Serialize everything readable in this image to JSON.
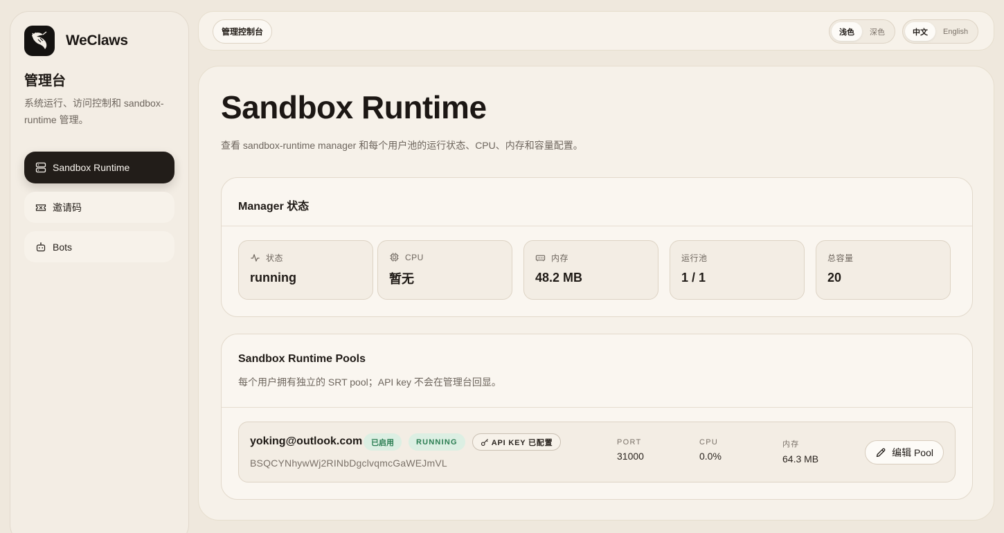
{
  "brand": {
    "name": "WeClaws",
    "logo_icon": "lobster-logo"
  },
  "sidebar": {
    "title": "管理台",
    "description": "系统运行、访问控制和 sandbox-runtime 管理。",
    "items": [
      {
        "label": "Sandbox Runtime",
        "icon": "server-icon",
        "active": true
      },
      {
        "label": "邀请码",
        "icon": "ticket-icon",
        "active": false
      },
      {
        "label": "Bots",
        "icon": "bot-icon",
        "active": false
      }
    ]
  },
  "topbar": {
    "breadcrumb": "管理控制台",
    "theme": {
      "light": "浅色",
      "dark": "深色",
      "selected": "浅色"
    },
    "language": {
      "zh": "中文",
      "en": "English",
      "selected": "中文"
    }
  },
  "main": {
    "title": "Sandbox Runtime",
    "description": "查看 sandbox-runtime manager 和每个用户池的运行状态、CPU、内存和容量配置。",
    "manager": {
      "title": "Manager 状态",
      "stats": [
        {
          "label": "状态",
          "value": "running",
          "icon": "activity-icon"
        },
        {
          "label": "CPU",
          "value": "暂无",
          "icon": "cpu-icon"
        },
        {
          "label": "内存",
          "value": "48.2 MB",
          "icon": "memory-icon"
        },
        {
          "label": "运行池",
          "value": "1 / 1",
          "icon": ""
        },
        {
          "label": "总容量",
          "value": "20",
          "icon": ""
        }
      ]
    },
    "pools": {
      "title": "Sandbox Runtime Pools",
      "subtitle": "每个用户拥有独立的 SRT pool；API key 不会在管理台回显。",
      "rows": [
        {
          "email": "yoking@outlook.com",
          "badge_enabled": "已启用",
          "badge_status": "RUNNING",
          "badge_apikey": "API KEY 已配置",
          "id": "BSQCYNhywWj2RINbDgclvqmcGaWEJmVL",
          "port_label": "PORT",
          "port": "31000",
          "cpu_label": "CPU",
          "cpu": "0.0%",
          "mem_label": "内存",
          "mem": "64.3 MB",
          "edit_label": "编辑 Pool"
        }
      ]
    }
  },
  "colors": {
    "background": "#efe8dd",
    "active_nav": "#221d19",
    "badge_green_bg": "#dcefe3",
    "badge_green_text": "#2a7d52"
  }
}
